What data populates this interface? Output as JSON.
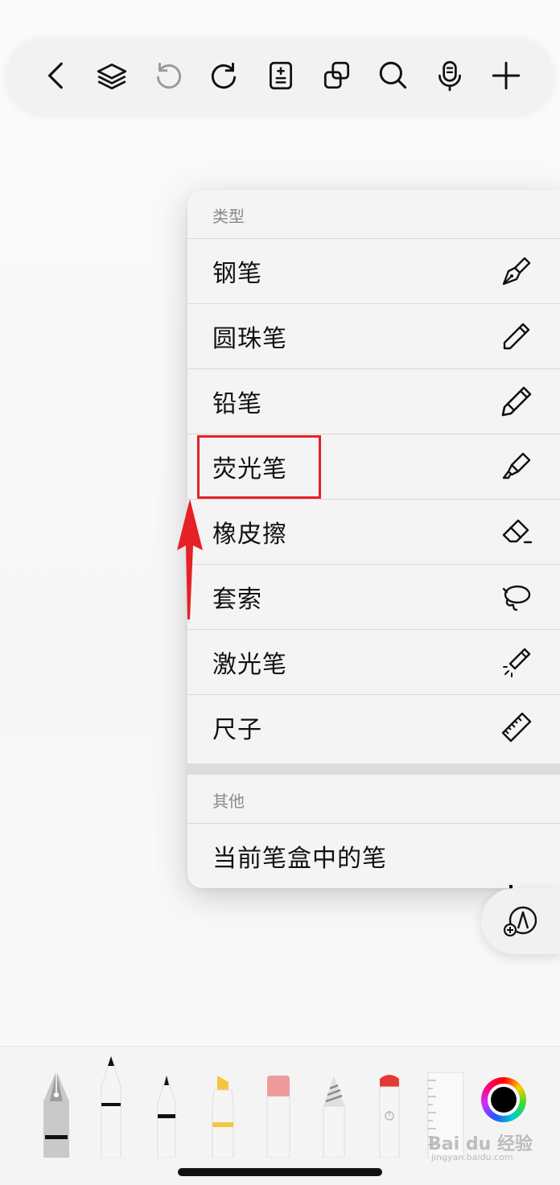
{
  "toolbar": {
    "icons": [
      "back-chevron-icon",
      "layers-icon",
      "undo-icon",
      "redo-icon",
      "page-adjust-icon",
      "duplicate-icon",
      "search-icon",
      "microphone-icon",
      "plus-icon"
    ]
  },
  "menu": {
    "section_type_title": "类型",
    "items": [
      {
        "label": "钢笔",
        "icon": "fountain-pen-icon"
      },
      {
        "label": "圆珠笔",
        "icon": "ballpoint-pen-icon"
      },
      {
        "label": "铅笔",
        "icon": "pencil-icon"
      },
      {
        "label": "荧光笔",
        "icon": "highlighter-icon"
      },
      {
        "label": "橡皮擦",
        "icon": "eraser-icon"
      },
      {
        "label": "套索",
        "icon": "lasso-icon"
      },
      {
        "label": "激光笔",
        "icon": "laser-pointer-icon"
      },
      {
        "label": "尺子",
        "icon": "ruler-icon"
      }
    ],
    "section_other_title": "其他",
    "other_items": [
      {
        "label": "当前笔盒中的笔"
      }
    ]
  },
  "annotation": {
    "highlighted_item": "荧光笔",
    "highlight_color": "#e52127"
  },
  "tray": {
    "tools": [
      "fountain-pen",
      "fineliner",
      "marker",
      "highlighter",
      "eraser",
      "pencil",
      "laser",
      "ruler"
    ],
    "current_color": "#000000"
  },
  "watermark": {
    "text": "Bai du 经验",
    "sub": "jingyan.baidu.com"
  }
}
